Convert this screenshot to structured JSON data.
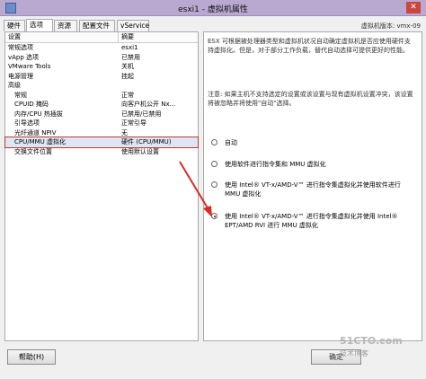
{
  "window": {
    "title": "esxi1 - 虚拟机属性"
  },
  "tabs": [
    {
      "label": "硬件"
    },
    {
      "label": "选项"
    },
    {
      "label": "资源"
    },
    {
      "label": "配置文件"
    },
    {
      "label": "vService"
    }
  ],
  "version_label": "虚拟机版本: vmx-09",
  "list": {
    "headers": {
      "setting": "设置",
      "summary": "摘要"
    },
    "rows": [
      {
        "setting": "常规选项",
        "summary": "esxi1"
      },
      {
        "setting": "vApp 选项",
        "summary": "已禁用"
      },
      {
        "setting": "VMware Tools",
        "summary": "关机"
      },
      {
        "setting": "电源管理",
        "summary": "挂起"
      },
      {
        "setting": "高级",
        "summary": ""
      },
      {
        "setting": "常规",
        "summary": "正常"
      },
      {
        "setting": "CPUID 掩码",
        "summary": "向客户机公开 Nx..."
      },
      {
        "setting": "内存/CPU 热插拔",
        "summary": "已禁用/已禁用"
      },
      {
        "setting": "引导选项",
        "summary": "正常引导"
      },
      {
        "setting": "光纤通道 NPIV",
        "summary": "无"
      },
      {
        "setting": "CPU/MMU 虚拟化",
        "summary": "硬件 (CPU/MMU)"
      },
      {
        "setting": "交换文件位置",
        "summary": "使用默认设置"
      }
    ]
  },
  "right_panel": {
    "description": "ESX 可根据被处理器类型和虚拟机状况自动确定虚拟机是否应使用硬件支持虚拟化。但是，对于部分工作负载，替代自动选择可提供更好的性能。",
    "note": "注意: 如果主机不支持选定的设置或该设置与现有虚拟机设置冲突，该设置将被忽略并将使用\"自动\"选择。",
    "options": [
      {
        "label": "自动",
        "selected": false
      },
      {
        "label": "使用软件进行指令集和 MMU 虚拟化",
        "selected": false
      },
      {
        "label": "使用 Intel® VT-x/AMD-V™ 进行指令集虚拟化并使用软件进行 MMU 虚拟化",
        "selected": false
      },
      {
        "label": "使用 Intel® VT-x/AMD-V™ 进行指令集虚拟化并使用 Intel® EPT/AMD RVI 进行 MMU 虚拟化",
        "selected": true
      }
    ]
  },
  "buttons": {
    "help": "帮助(H)",
    "ok": "确定"
  },
  "watermark": {
    "site": "51CTO.com",
    "sub": "技术博客"
  },
  "colors": {
    "titlebar": "#b9a8d0",
    "highlight": "#c0392b",
    "arrow": "#d92b23"
  },
  "icons": {
    "app": "window-app-icon",
    "close": "close-icon"
  }
}
